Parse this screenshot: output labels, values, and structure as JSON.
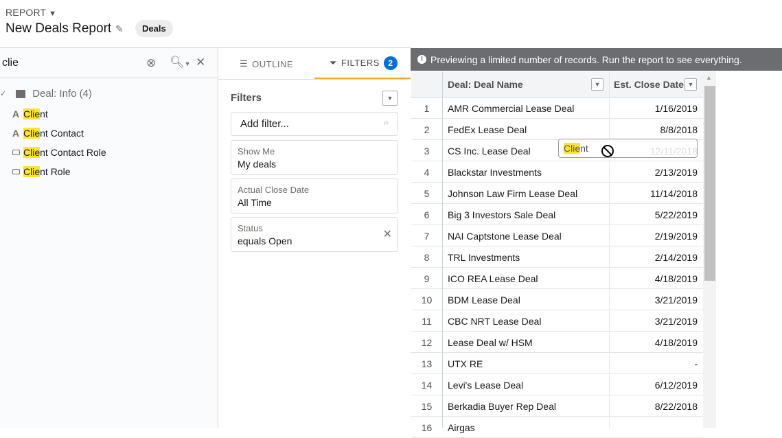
{
  "header": {
    "type_label": "REPORT",
    "title": "New Deals Report",
    "badge": "Deals"
  },
  "field_search": {
    "value": "clie",
    "group": "Deal: Info (4)",
    "items": [
      {
        "match": "Clie",
        "rest": "nt",
        "icon": "text-icon"
      },
      {
        "match": "Clie",
        "rest": "nt Contact",
        "icon": "text-icon"
      },
      {
        "match": "Clie",
        "rest": "nt Contact Role",
        "icon": "picklist-icon"
      },
      {
        "match": "Clie",
        "rest": "nt Role",
        "icon": "picklist-icon"
      }
    ]
  },
  "tabs": {
    "outline": "OUTLINE",
    "filters": "FILTERS",
    "filters_count": "2"
  },
  "filters": {
    "title": "Filters",
    "add_placeholder": "Add filter...",
    "cards": [
      {
        "label": "Show Me",
        "value": "My deals"
      },
      {
        "label": "Actual Close Date",
        "value": "All Time"
      },
      {
        "label": "Status",
        "value": "equals Open"
      }
    ]
  },
  "banner": "Previewing a limited number of records. Run the report to see everything.",
  "table": {
    "columns": [
      "Deal: Deal Name",
      "Est. Close Date"
    ],
    "rows": [
      [
        "1",
        "AMR Commercial Lease Deal",
        "1/16/2019"
      ],
      [
        "2",
        "FedEx Lease Deal",
        "8/8/2018"
      ],
      [
        "3",
        "CS Inc. Lease Deal",
        "12/11/2018"
      ],
      [
        "4",
        "Blackstar Investments",
        "2/13/2019"
      ],
      [
        "5",
        "Johnson Law Firm Lease Deal",
        "11/14/2018"
      ],
      [
        "6",
        "Big 3 Investors Sale Deal",
        "5/22/2019"
      ],
      [
        "7",
        "NAI Captstone Lease Deal",
        "2/19/2019"
      ],
      [
        "8",
        "TRL Investments",
        "2/14/2019"
      ],
      [
        "9",
        "ICO REA Lease Deal",
        "4/18/2019"
      ],
      [
        "10",
        "BDM Lease Deal",
        "3/21/2019"
      ],
      [
        "11",
        "CBC NRT Lease Deal",
        "3/21/2019"
      ],
      [
        "12",
        "Lease Deal w/ HSM",
        "4/18/2019"
      ],
      [
        "13",
        "UTX RE",
        "-"
      ],
      [
        "14",
        "Levi's Lease Deal",
        "6/12/2019"
      ],
      [
        "15",
        "Berkadia Buyer Rep Deal",
        "8/22/2018"
      ],
      [
        "16",
        "Airgas",
        ""
      ]
    ]
  },
  "drag_ghost": {
    "match": "Clie",
    "rest": "nt"
  }
}
